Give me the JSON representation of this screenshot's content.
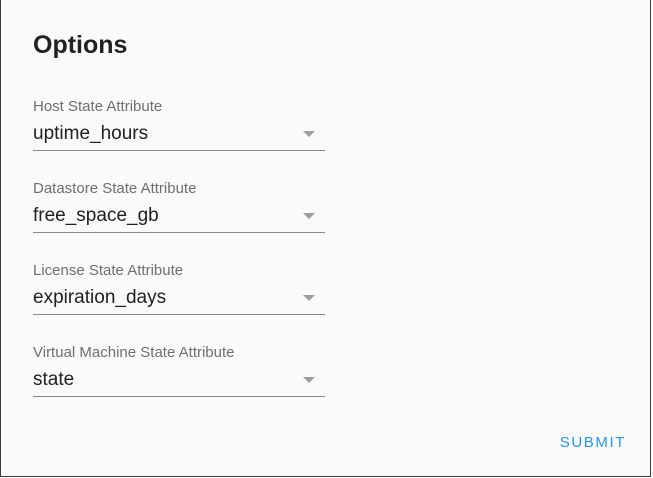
{
  "dialog": {
    "title": "Options",
    "fields": [
      {
        "label": "Host State Attribute",
        "value": "uptime_hours"
      },
      {
        "label": "Datastore State Attribute",
        "value": "free_space_gb"
      },
      {
        "label": "License State Attribute",
        "value": "expiration_days"
      },
      {
        "label": "Virtual Machine State Attribute",
        "value": "state"
      }
    ],
    "submit_label": "SUBMIT"
  },
  "colors": {
    "accent": "#2196f3",
    "text": "#212121",
    "label": "#6f6f6f",
    "background": "#fafafa"
  },
  "icons": {
    "dropdown": "chevron-down-icon"
  }
}
